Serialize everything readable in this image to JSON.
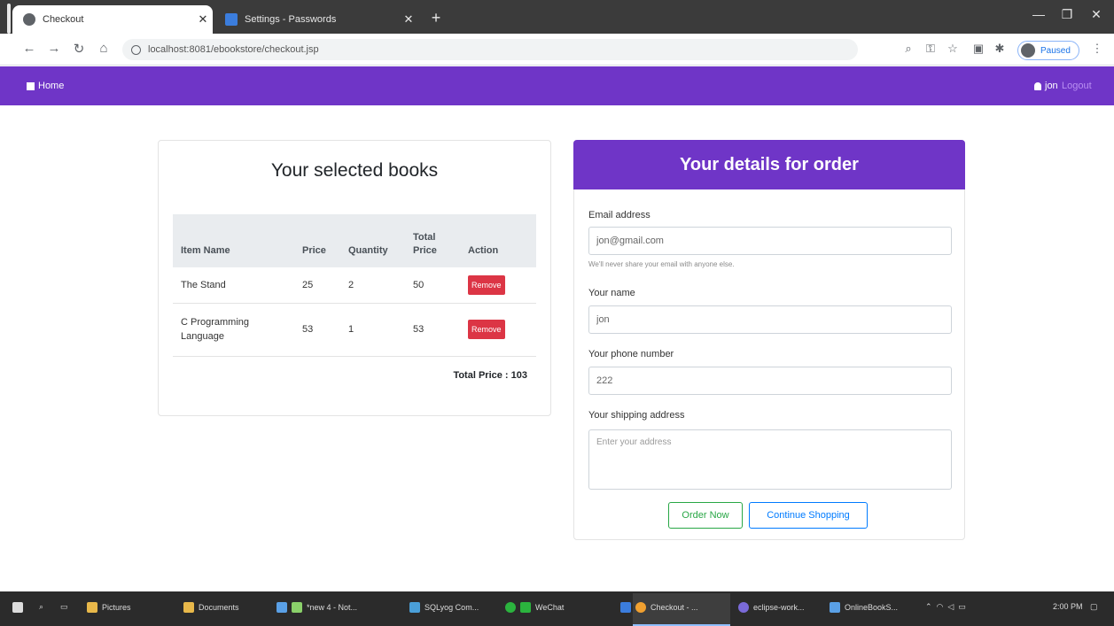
{
  "browser": {
    "tabs": [
      {
        "label": "Checkout",
        "active": true
      },
      {
        "label": "Settings - Passwords",
        "active": false
      }
    ],
    "url": "localhost:8081/ebookstore/checkout.jsp",
    "profile_status": "Paused"
  },
  "nav": {
    "home": "Home",
    "user": "jon",
    "logout": "Logout"
  },
  "cart": {
    "title": "Your selected books",
    "columns": [
      "Item Name",
      "Price",
      "Quantity",
      "Total Price",
      "Action"
    ],
    "rows": [
      {
        "name": "The Stand",
        "price": "25",
        "quantity": "2",
        "total": "50",
        "action": "Remove"
      },
      {
        "name": "C Programming Language",
        "price": "53",
        "quantity": "1",
        "total": "53",
        "action": "Remove"
      }
    ],
    "total_label": "Total Price : 103"
  },
  "form": {
    "title": "Your details for order",
    "email_label": "Email address",
    "email_value": "jon@gmail.com",
    "email_help": "We'll never share your email with anyone else.",
    "name_label": "Your name",
    "name_value": "jon",
    "phone_label": "Your phone number",
    "phone_value": "222",
    "address_label": "Your shipping address",
    "address_placeholder": "Enter your address",
    "order_btn": "Order Now",
    "continue_btn": "Continue Shopping"
  },
  "taskbar": {
    "items": [
      "Pictures",
      "Documents",
      "*new 4 - Not...",
      "SQLyog Com...",
      "WeChat",
      "Checkout - ...",
      "eclipse-work...",
      "OnlineBookS..."
    ],
    "time": "2:00 PM"
  },
  "colors": {
    "brand_purple": "#6f35c7",
    "danger": "#dc3545",
    "success": "#28a745",
    "primary": "#007bff"
  }
}
